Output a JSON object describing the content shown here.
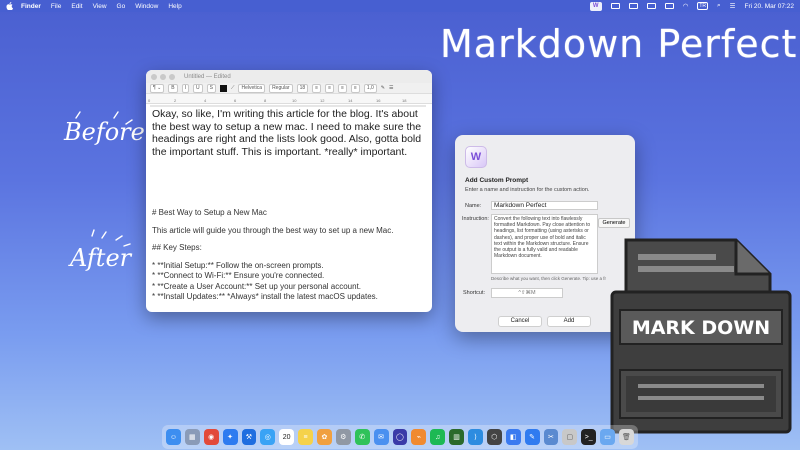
{
  "menubar": {
    "app_name": "Finder",
    "items": [
      "File",
      "Edit",
      "View",
      "Go",
      "Window",
      "Help"
    ],
    "status_kbd": "TR",
    "clock": "Fri 20. Mar  07:22",
    "menu_app_icon_letter": "W"
  },
  "overlay": {
    "title": "Markdown Perfect",
    "before_label": "Before",
    "after_label": "After"
  },
  "textedit": {
    "title": "Untitled — Edited",
    "toolbar": {
      "font": "Helvetica",
      "style": "Regular",
      "size": "18",
      "spacing": "1,0"
    },
    "before_text": "Okay, so like, I'm writing this article for the blog. It's about the best way to setup a new mac.  I need to make sure the headings are right and the lists look good.  Also, gotta bold the important stuff.  This is important.  *really* important.",
    "after": {
      "heading": "# Best Way to Setup a New Mac",
      "intro": "This article will guide you through the best way to set up a new Mac.",
      "subheading": "## Key Steps:",
      "steps": [
        "*   **Initial Setup:** Follow the on-screen prompts.",
        "*   **Connect to Wi-Fi:** Ensure you're connected.",
        "*   **Create a User Account:** Set up your personal account.",
        "*   **Install Updates:** *Always* install the latest macOS updates."
      ]
    }
  },
  "dialog": {
    "app_icon_letter": "W",
    "title": "Add Custom Prompt",
    "subtitle": "Enter a name and instruction for the custom action.",
    "name_label": "Name:",
    "name_value": "Markdown Perfect",
    "instruction_label": "Instruction:",
    "instruction_value": "Convert the following text into flawlessly formatted Markdown. Pay close attention to headings, list formatting (using asterisks or dashes), and proper use of bold and italic text within the Markdown structure. Ensure the output is a fully valid and readable Markdown document.",
    "generate_label": "Generate",
    "hint": "Describe what you want, then click Generate. Tip: use a fr",
    "shortcut_label": "Shortcut:",
    "shortcut_value": "^⇧⌘M",
    "cancel_label": "Cancel",
    "add_label": "Add"
  },
  "md_icon": {
    "label": "MARK DOWN"
  },
  "dock": {
    "calendar_day": "20",
    "apps": [
      {
        "name": "finder",
        "color": "#3d8ef0",
        "glyph": "☺"
      },
      {
        "name": "launchpad",
        "color": "#8a9bb8",
        "glyph": "▦"
      },
      {
        "name": "chrome",
        "color": "#e24a3b",
        "glyph": "◉"
      },
      {
        "name": "safari",
        "color": "#2d7bf0",
        "glyph": "✦"
      },
      {
        "name": "xcode",
        "color": "#1f6ee0",
        "glyph": "⚒"
      },
      {
        "name": "safari-blue",
        "color": "#3aa3f5",
        "glyph": "◎"
      },
      {
        "name": "calendar",
        "color": "#ffffff",
        "glyph": "20"
      },
      {
        "name": "notes",
        "color": "#f5d24b",
        "glyph": "≡"
      },
      {
        "name": "photos",
        "color": "#f0a040",
        "glyph": "✿"
      },
      {
        "name": "settings",
        "color": "#9098a4",
        "glyph": "⚙"
      },
      {
        "name": "whatsapp",
        "color": "#2fc25a",
        "glyph": "✆"
      },
      {
        "name": "mail",
        "color": "#4a90f0",
        "glyph": "✉"
      },
      {
        "name": "app-dark",
        "color": "#3a3aa8",
        "glyph": "◯"
      },
      {
        "name": "keynote",
        "color": "#f08a30",
        "glyph": "⌁"
      },
      {
        "name": "spotify",
        "color": "#1db954",
        "glyph": "♫"
      },
      {
        "name": "terminal-green",
        "color": "#2b6a2b",
        "glyph": "▥"
      },
      {
        "name": "vscode",
        "color": "#2d8ce0",
        "glyph": "⟩"
      },
      {
        "name": "app-cube",
        "color": "#444444",
        "glyph": "⬡"
      },
      {
        "name": "app-blue",
        "color": "#3a7af0",
        "glyph": "◧"
      },
      {
        "name": "messages",
        "color": "#2f7bf0",
        "glyph": "✎"
      },
      {
        "name": "app-tools",
        "color": "#5a8ad0",
        "glyph": "✂"
      },
      {
        "name": "app-gray",
        "color": "#c8c8c8",
        "glyph": "▢"
      },
      {
        "name": "terminal",
        "color": "#222222",
        "glyph": ">_"
      },
      {
        "name": "folder",
        "color": "#6aa8f0",
        "glyph": "▭"
      },
      {
        "name": "trash",
        "color": "#d8d8d8",
        "glyph": "🗑"
      }
    ]
  }
}
